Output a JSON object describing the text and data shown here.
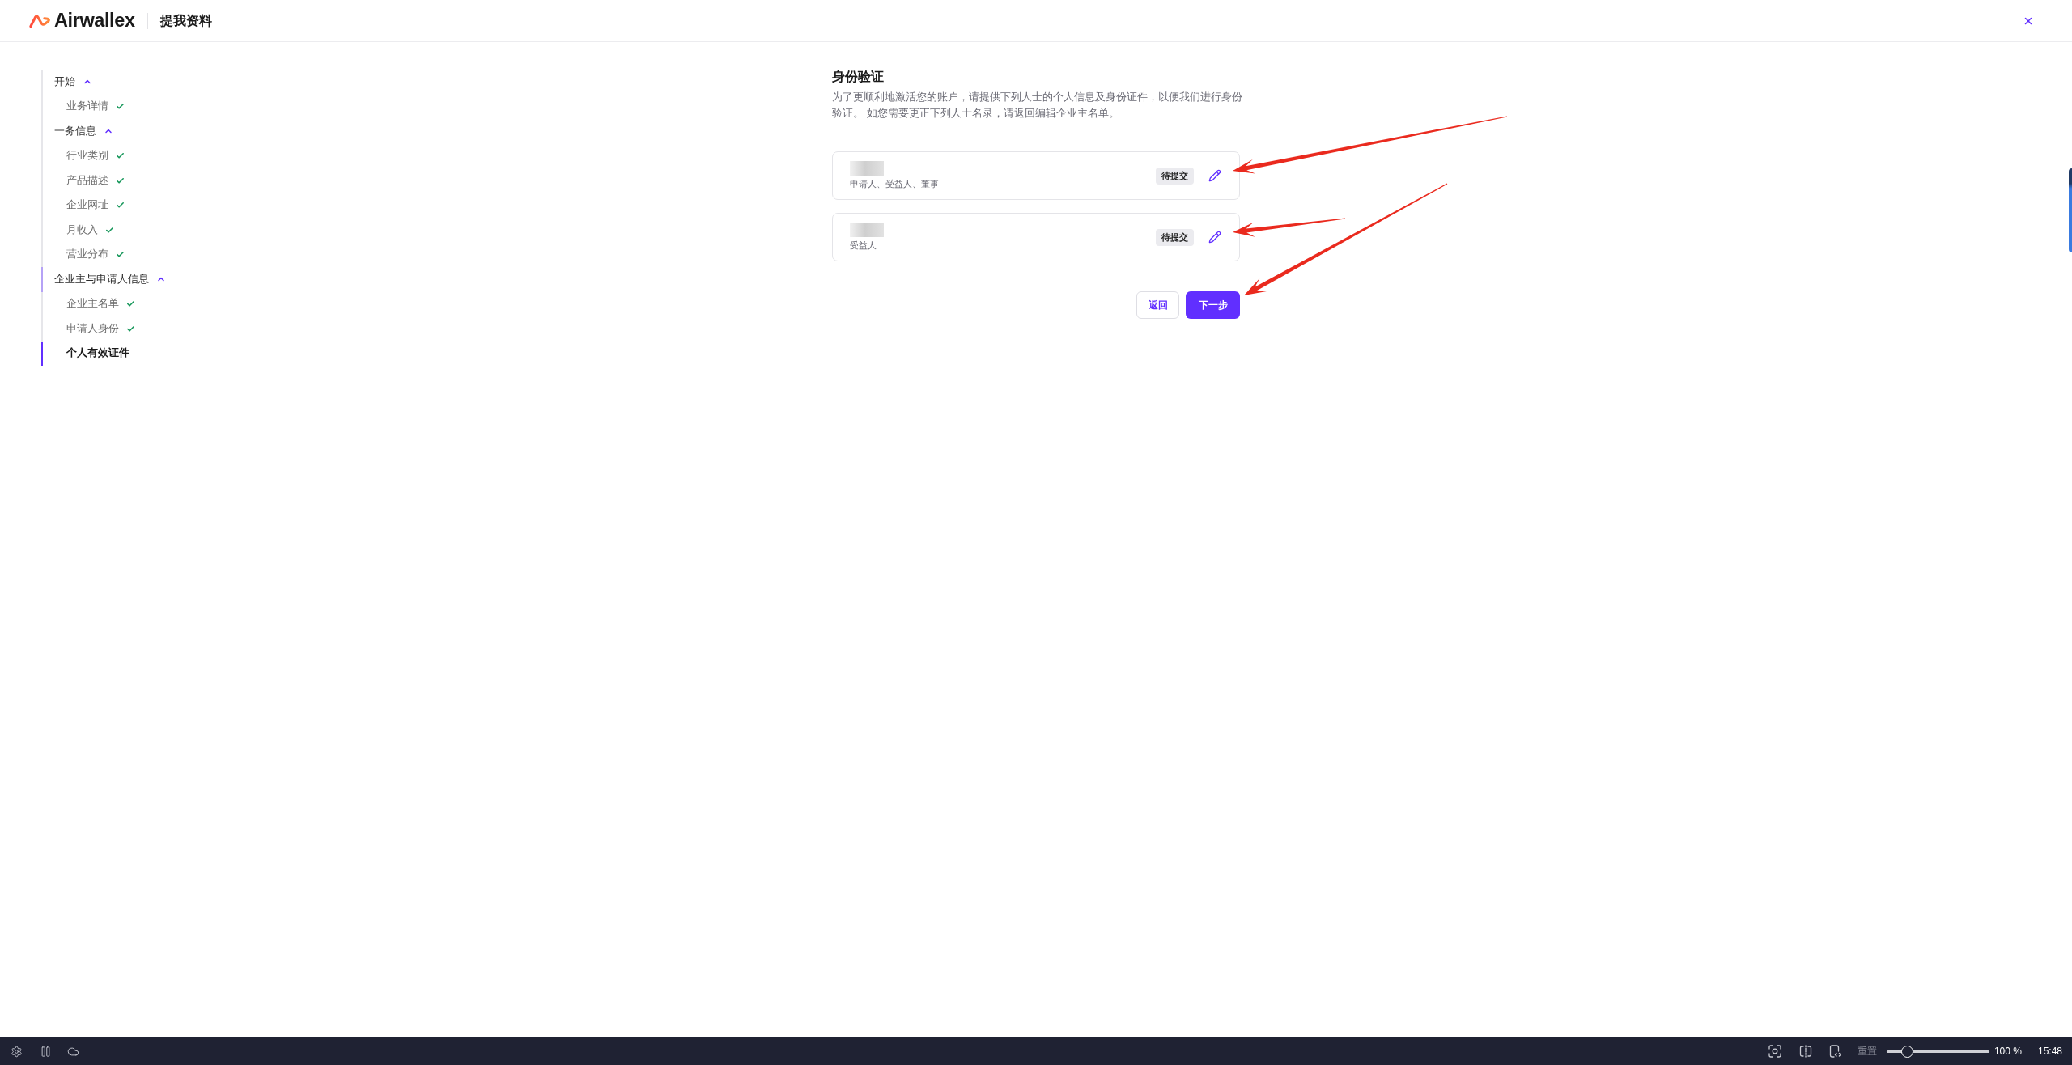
{
  "header": {
    "logo_text": "Airwallex",
    "title": "提我资料"
  },
  "sidebar": {
    "sections": [
      {
        "label": "开始",
        "expanded": true,
        "selected": false,
        "children": [
          {
            "label": "业务详情",
            "completed": true,
            "selected": false
          }
        ]
      },
      {
        "label": "一务信息",
        "expanded": true,
        "selected": false,
        "children": [
          {
            "label": "行业类别",
            "completed": true,
            "selected": false
          },
          {
            "label": "产品描述",
            "completed": true,
            "selected": false
          },
          {
            "label": "企业网址",
            "completed": true,
            "selected": false
          },
          {
            "label": "月收入",
            "completed": true,
            "selected": false
          },
          {
            "label": "营业分布",
            "completed": true,
            "selected": false
          }
        ]
      },
      {
        "label": "企业主与申请人信息",
        "expanded": true,
        "selected": true,
        "children": [
          {
            "label": "企业主名单",
            "completed": true,
            "selected": false
          },
          {
            "label": "申请人身份",
            "completed": true,
            "selected": false
          },
          {
            "label": "个人有效证件",
            "completed": false,
            "selected": true
          }
        ]
      }
    ]
  },
  "main": {
    "title": "身份验证",
    "description": "为了更顺利地激活您的账户，请提供下列人士的个人信息及身份证件，以便我们进行身份验证。 如您需要更正下列人士名录，请返回编辑企业主名单。",
    "people": [
      {
        "roles": "申请人、受益人、董事",
        "status": "待提交"
      },
      {
        "roles": "受益人",
        "status": "待提交"
      }
    ],
    "buttons": {
      "back": "返回",
      "next": "下一步"
    }
  },
  "taskbar": {
    "reset_label": "重置",
    "zoom": {
      "level": 0.2,
      "reading": "100 %"
    },
    "clock": "15:48"
  }
}
